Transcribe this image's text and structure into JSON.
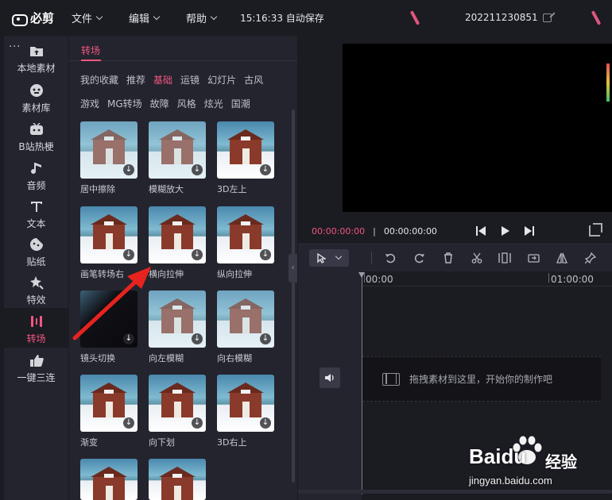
{
  "app": {
    "name": "必剪",
    "menus": [
      "文件",
      "编辑",
      "帮助"
    ],
    "autosave": "15:16:33 自动保存",
    "project_name": "202211230851",
    "accent": "#f1577f"
  },
  "sidebar": {
    "more_icon": "...",
    "items": [
      {
        "label": "本地素材",
        "icon": "upload-icon"
      },
      {
        "label": "素材库",
        "icon": "library-icon"
      },
      {
        "label": "B站热梗",
        "icon": "bilibili-icon"
      },
      {
        "label": "音频",
        "icon": "music-icon"
      },
      {
        "label": "文本",
        "icon": "text-icon"
      },
      {
        "label": "贴纸",
        "icon": "sticker-icon"
      },
      {
        "label": "特效",
        "icon": "effects-icon"
      },
      {
        "label": "转场",
        "icon": "transition-icon",
        "active": true
      },
      {
        "label": "一键三连",
        "icon": "thumbs-up-icon"
      }
    ]
  },
  "panel": {
    "title": "转场",
    "categories_row1": [
      "我的收藏",
      "推荐",
      "基础",
      "运镜",
      "幻灯片",
      "古风"
    ],
    "categories_row2": [
      "游戏",
      "MG转场",
      "故障",
      "风格",
      "炫光",
      "国潮"
    ],
    "active_category": "基础",
    "tiles": [
      {
        "label": "居中擦除"
      },
      {
        "label": "模糊放大"
      },
      {
        "label": "3D左上"
      },
      {
        "label": "画笔转场右"
      },
      {
        "label": "横向拉伸"
      },
      {
        "label": "纵向拉伸"
      },
      {
        "label": "镜头切换"
      },
      {
        "label": "向左模糊"
      },
      {
        "label": "向右模糊"
      },
      {
        "label": "渐变"
      },
      {
        "label": "向下划"
      },
      {
        "label": "3D右上"
      },
      {
        "label": ""
      },
      {
        "label": ""
      }
    ],
    "download_glyph": "↓"
  },
  "preview": {
    "current_time": "00:00:00:00",
    "separator": "|",
    "total_time": "00:00:00:00"
  },
  "timeline": {
    "ruler_start": "00:00",
    "ruler_mark": "01:00:00",
    "drop_hint": "拖拽素材到这里，开始你的制作吧"
  },
  "watermark": {
    "brand": "Baidu",
    "brand_cn": "经验",
    "url": "jingyan.baidu.com"
  }
}
